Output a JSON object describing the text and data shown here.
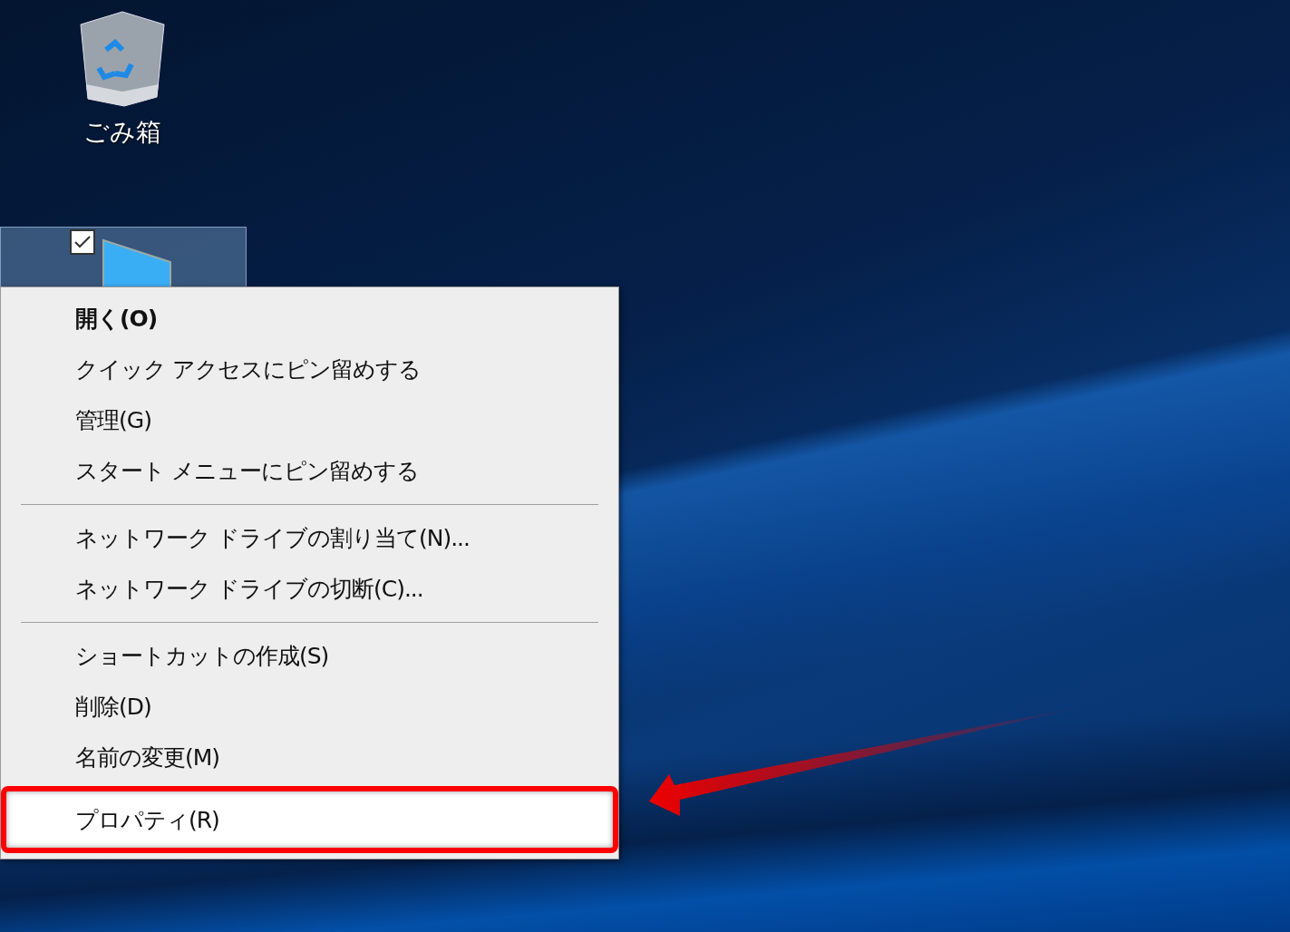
{
  "desktop_icons": [
    {
      "kind": "recycle-bin",
      "label": "ごみ箱",
      "selected": false
    },
    {
      "kind": "computer",
      "selected": true,
      "checked": true
    }
  ],
  "context_menu": {
    "items": [
      {
        "kind": "item",
        "label": "開く(O)",
        "default": true,
        "selected": false
      },
      {
        "kind": "item",
        "label": "クイック アクセスにピン留めする",
        "default": false,
        "selected": false
      },
      {
        "kind": "item",
        "label": "管理(G)",
        "default": false,
        "selected": false
      },
      {
        "kind": "item",
        "label": "スタート メニューにピン留めする",
        "default": false,
        "selected": false
      },
      {
        "kind": "separator"
      },
      {
        "kind": "item",
        "label": "ネットワーク ドライブの割り当て(N)...",
        "default": false,
        "selected": false
      },
      {
        "kind": "item",
        "label": "ネットワーク ドライブの切断(C)...",
        "default": false,
        "selected": false
      },
      {
        "kind": "separator"
      },
      {
        "kind": "item",
        "label": "ショートカットの作成(S)",
        "default": false,
        "selected": false
      },
      {
        "kind": "item",
        "label": "削除(D)",
        "default": false,
        "selected": false
      },
      {
        "kind": "item",
        "label": "名前の変更(M)",
        "default": false,
        "selected": false
      },
      {
        "kind": "item",
        "label": "プロパティ(R)",
        "default": false,
        "selected": true,
        "highlighted": true
      }
    ]
  },
  "annotation": {
    "arrow": true
  }
}
